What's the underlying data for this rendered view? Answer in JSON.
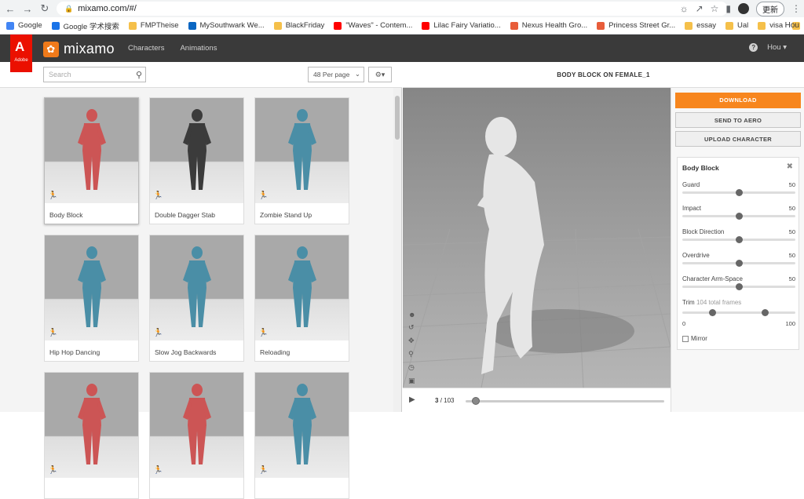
{
  "browser": {
    "url": "mixamo.com/#/",
    "update_label": "更新",
    "bookmarks": [
      {
        "label": "Google",
        "color": "#4285f4"
      },
      {
        "label": "Google 学术搜索",
        "color": "#1a73e8"
      },
      {
        "label": "FMPTheise",
        "color": "#f5c04a"
      },
      {
        "label": "MySouthwark We...",
        "color": "#0a66c2"
      },
      {
        "label": "BlackFriday",
        "color": "#f5c04a"
      },
      {
        "label": "\"Waves\" - Contem...",
        "color": "#ff0000"
      },
      {
        "label": "Lilac Fairy Variatio...",
        "color": "#ff0000"
      },
      {
        "label": "Nexus Health Gro...",
        "color": "#e85d3a"
      },
      {
        "label": "Princess Street Gr...",
        "color": "#e85d3a"
      },
      {
        "label": "essay",
        "color": "#f5c04a"
      },
      {
        "label": "Ual",
        "color": "#f5c04a"
      },
      {
        "label": "visa",
        "color": "#f5c04a"
      },
      {
        "label": "抢票",
        "color": "#f5c04a"
      }
    ],
    "bookmarks_more": "Hou"
  },
  "app": {
    "adobe_label": "Adobe",
    "adobe_glyph": "A",
    "brand": "mixamo",
    "nav": [
      "Characters",
      "Animations"
    ],
    "user": "Hou",
    "help_glyph": "?"
  },
  "toolbar": {
    "search_placeholder": "Search",
    "per_page": "48 Per page"
  },
  "animations": [
    {
      "label": "Body Block",
      "color": "#cc5555",
      "selected": true
    },
    {
      "label": "Double Dagger Stab",
      "color": "#3b3b3b",
      "selected": false
    },
    {
      "label": "Zombie Stand Up",
      "color": "#4a8ea6",
      "selected": false
    },
    {
      "label": "Hip Hop Dancing",
      "color": "#4a8ea6",
      "selected": false
    },
    {
      "label": "Slow Jog Backwards",
      "color": "#4a8ea6",
      "selected": false
    },
    {
      "label": "Reloading",
      "color": "#4a8ea6",
      "selected": false
    },
    {
      "label": "",
      "color": "#cc5555",
      "selected": false
    },
    {
      "label": "",
      "color": "#cc5555",
      "selected": false
    },
    {
      "label": "",
      "color": "#4a8ea6",
      "selected": false
    }
  ],
  "viewer": {
    "title": "BODY BLOCK ON FEMALE_1",
    "frame_current": "3",
    "frame_total": "/ 103",
    "timeline_progress": 0.03
  },
  "actions": {
    "download": "DOWNLOAD",
    "send_to_aero": "SEND TO AERO",
    "upload_character": "UPLOAD CHARACTER"
  },
  "params": {
    "title": "Body Block",
    "sliders": [
      {
        "name": "Guard",
        "value": "50",
        "fraction": 0.5
      },
      {
        "name": "Impact",
        "value": "50",
        "fraction": 0.5
      },
      {
        "name": "Block Direction",
        "value": "50",
        "fraction": 0.5
      },
      {
        "name": "Overdrive",
        "value": "50",
        "fraction": 0.5
      },
      {
        "name": "Character Arm-Space",
        "value": "50",
        "fraction": 0.5
      }
    ],
    "trim_label": "Trim",
    "trim_frames": "104 total frames",
    "trim_min": "0",
    "trim_max": "100",
    "trim_start": 0.27,
    "trim_end": 0.73,
    "mirror_label": "Mirror"
  }
}
